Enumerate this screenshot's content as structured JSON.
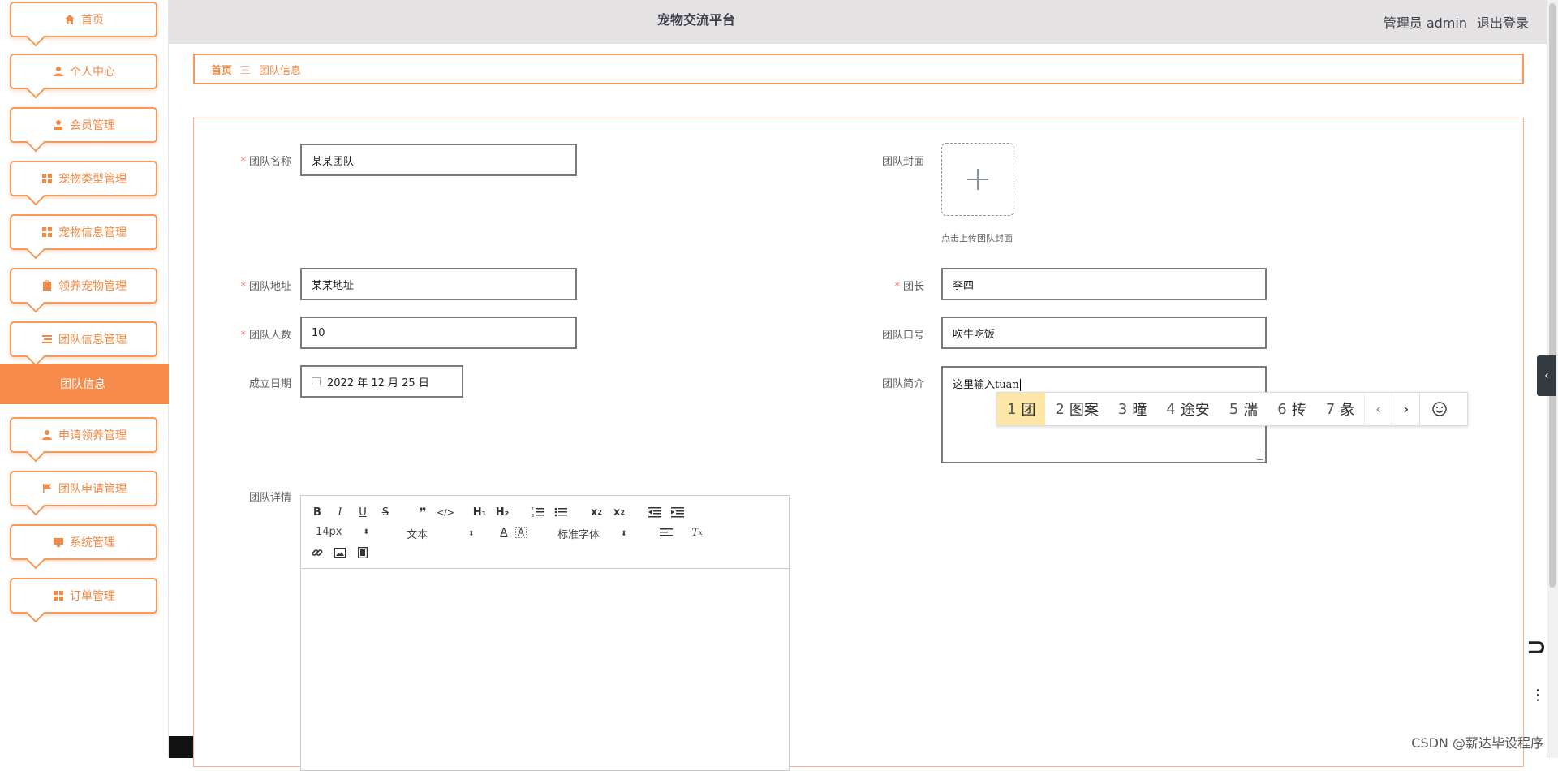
{
  "header": {
    "title": "宠物交流平台",
    "user_label": "管理员 admin",
    "logout_label": "退出登录"
  },
  "sidebar": {
    "items": [
      {
        "label": "首页",
        "icon": "home-icon"
      },
      {
        "label": "个人中心",
        "icon": "user-icon"
      },
      {
        "label": "会员管理",
        "icon": "member-icon"
      },
      {
        "label": "宠物类型管理",
        "icon": "grid-icon"
      },
      {
        "label": "宠物信息管理",
        "icon": "grid-icon"
      },
      {
        "label": "领养宠物管理",
        "icon": "clipboard-icon"
      },
      {
        "label": "团队信息管理",
        "icon": "list-icon"
      },
      {
        "label": "申请领养管理",
        "icon": "user-icon"
      },
      {
        "label": "团队申请管理",
        "icon": "flag-icon"
      },
      {
        "label": "系统管理",
        "icon": "monitor-icon"
      },
      {
        "label": "订单管理",
        "icon": "grid-icon"
      }
    ],
    "active_sub": "团队信息"
  },
  "breadcrumb": {
    "home": "首页",
    "separator": "三",
    "current": "团队信息"
  },
  "form": {
    "team_name_label": "团队名称",
    "team_name_value": "某某团队",
    "cover_label": "团队封面",
    "cover_tip": "点击上传团队封面",
    "address_label": "团队地址",
    "address_value": "某某地址",
    "leader_label": "团长",
    "leader_value": "李四",
    "count_label": "团队人数",
    "count_value": "10",
    "slogan_label": "团队口号",
    "slogan_value": "吹牛吃饭",
    "date_label": "成立日期",
    "date_value": "2022 年 12 月 25 日",
    "intro_label": "团队简介",
    "intro_value": "这里输入tuan",
    "detail_label": "团队详情",
    "required_mark": "*"
  },
  "editor": {
    "font_size": "14px",
    "paragraph": "文本",
    "font_family": "标准字体"
  },
  "ime": {
    "candidates": [
      {
        "n": "1",
        "text": "团"
      },
      {
        "n": "2",
        "text": "图案"
      },
      {
        "n": "3",
        "text": "曈"
      },
      {
        "n": "4",
        "text": "途安"
      },
      {
        "n": "5",
        "text": "湍"
      },
      {
        "n": "6",
        "text": "抟"
      },
      {
        "n": "7",
        "text": "彖"
      }
    ],
    "selected_index": 0
  },
  "watermark": "CSDN @薪达毕设程序",
  "colors": {
    "accent": "#f68b4c",
    "border_accent": "#f39a5e",
    "header_bg": "#e4e2e2",
    "required": "#f56c6c",
    "ime_selected": "#fde6a6"
  }
}
